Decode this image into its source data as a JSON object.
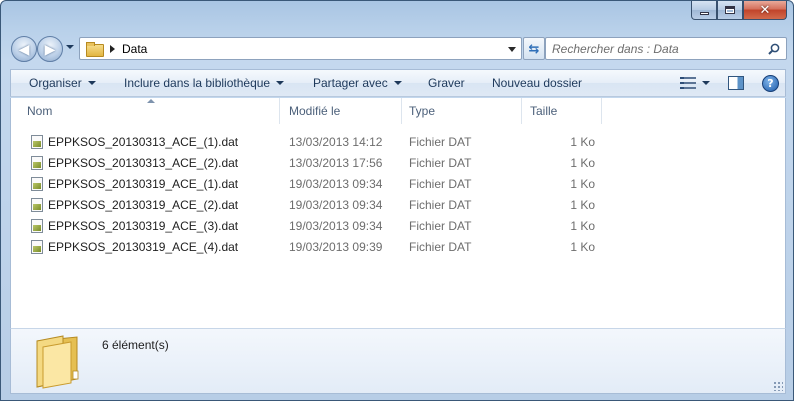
{
  "window": {
    "caption_buttons": {
      "minimize": "minimize",
      "maximize": "maximize",
      "close": "close"
    }
  },
  "address": {
    "path": "Data"
  },
  "search": {
    "placeholder": "Rechercher dans : Data"
  },
  "toolbar": {
    "organize_label": "Organiser",
    "include_label": "Inclure dans la bibliothèque",
    "share_label": "Partager avec",
    "burn_label": "Graver",
    "new_folder_label": "Nouveau dossier"
  },
  "columns": {
    "name": "Nom",
    "modified": "Modifié le",
    "type": "Type",
    "size": "Taille"
  },
  "files": [
    {
      "name": "EPPKSOS_20130313_ACE_(1).dat",
      "modified": "13/03/2013 14:12",
      "type": "Fichier DAT",
      "size": "1 Ko"
    },
    {
      "name": "EPPKSOS_20130313_ACE_(2).dat",
      "modified": "13/03/2013 17:56",
      "type": "Fichier DAT",
      "size": "1 Ko"
    },
    {
      "name": "EPPKSOS_20130319_ACE_(1).dat",
      "modified": "19/03/2013 09:34",
      "type": "Fichier DAT",
      "size": "1 Ko"
    },
    {
      "name": "EPPKSOS_20130319_ACE_(2).dat",
      "modified": "19/03/2013 09:34",
      "type": "Fichier DAT",
      "size": "1 Ko"
    },
    {
      "name": "EPPKSOS_20130319_ACE_(3).dat",
      "modified": "19/03/2013 09:34",
      "type": "Fichier DAT",
      "size": "1 Ko"
    },
    {
      "name": "EPPKSOS_20130319_ACE_(4).dat",
      "modified": "19/03/2013 09:39",
      "type": "Fichier DAT",
      "size": "1 Ko"
    }
  ],
  "details": {
    "count_text": "6 élément(s)"
  },
  "colors": {
    "frame": "#b9d1ea",
    "command_text": "#1e395b",
    "secondary_text": "#6d6d6d",
    "close_button": "#c1442a"
  }
}
